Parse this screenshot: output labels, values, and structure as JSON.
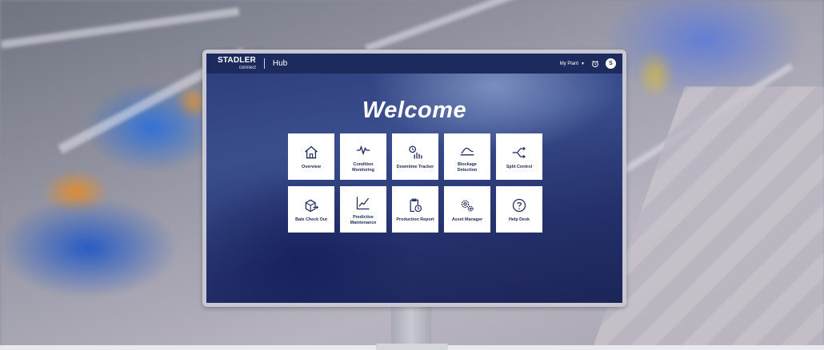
{
  "header": {
    "brand_name": "STADLER",
    "brand_sub": "connect",
    "app_title": "Hub",
    "plant_selector": "My Plant",
    "user_initial": "S"
  },
  "main": {
    "heading": "Welcome",
    "tiles": [
      {
        "label": "Overview",
        "icon": "home-icon"
      },
      {
        "label": "Condition Monitoring",
        "icon": "pulse-icon"
      },
      {
        "label": "Downtime Tracker",
        "icon": "stopwatch-bars-icon"
      },
      {
        "label": "Blockage Detection",
        "icon": "blockage-icon"
      },
      {
        "label": "Split Control",
        "icon": "split-arrow-icon"
      },
      {
        "label": "Bale Check Out",
        "icon": "box-arrow-icon"
      },
      {
        "label": "Predictive Maintenance",
        "icon": "trend-chart-icon"
      },
      {
        "label": "Production Report",
        "icon": "clipboard-clock-icon"
      },
      {
        "label": "Asset Manager",
        "icon": "gears-icon"
      },
      {
        "label": "Help Desk",
        "icon": "question-icon"
      }
    ]
  },
  "colors": {
    "navy": "#1d2a5e",
    "tile_bg": "#ffffff"
  }
}
